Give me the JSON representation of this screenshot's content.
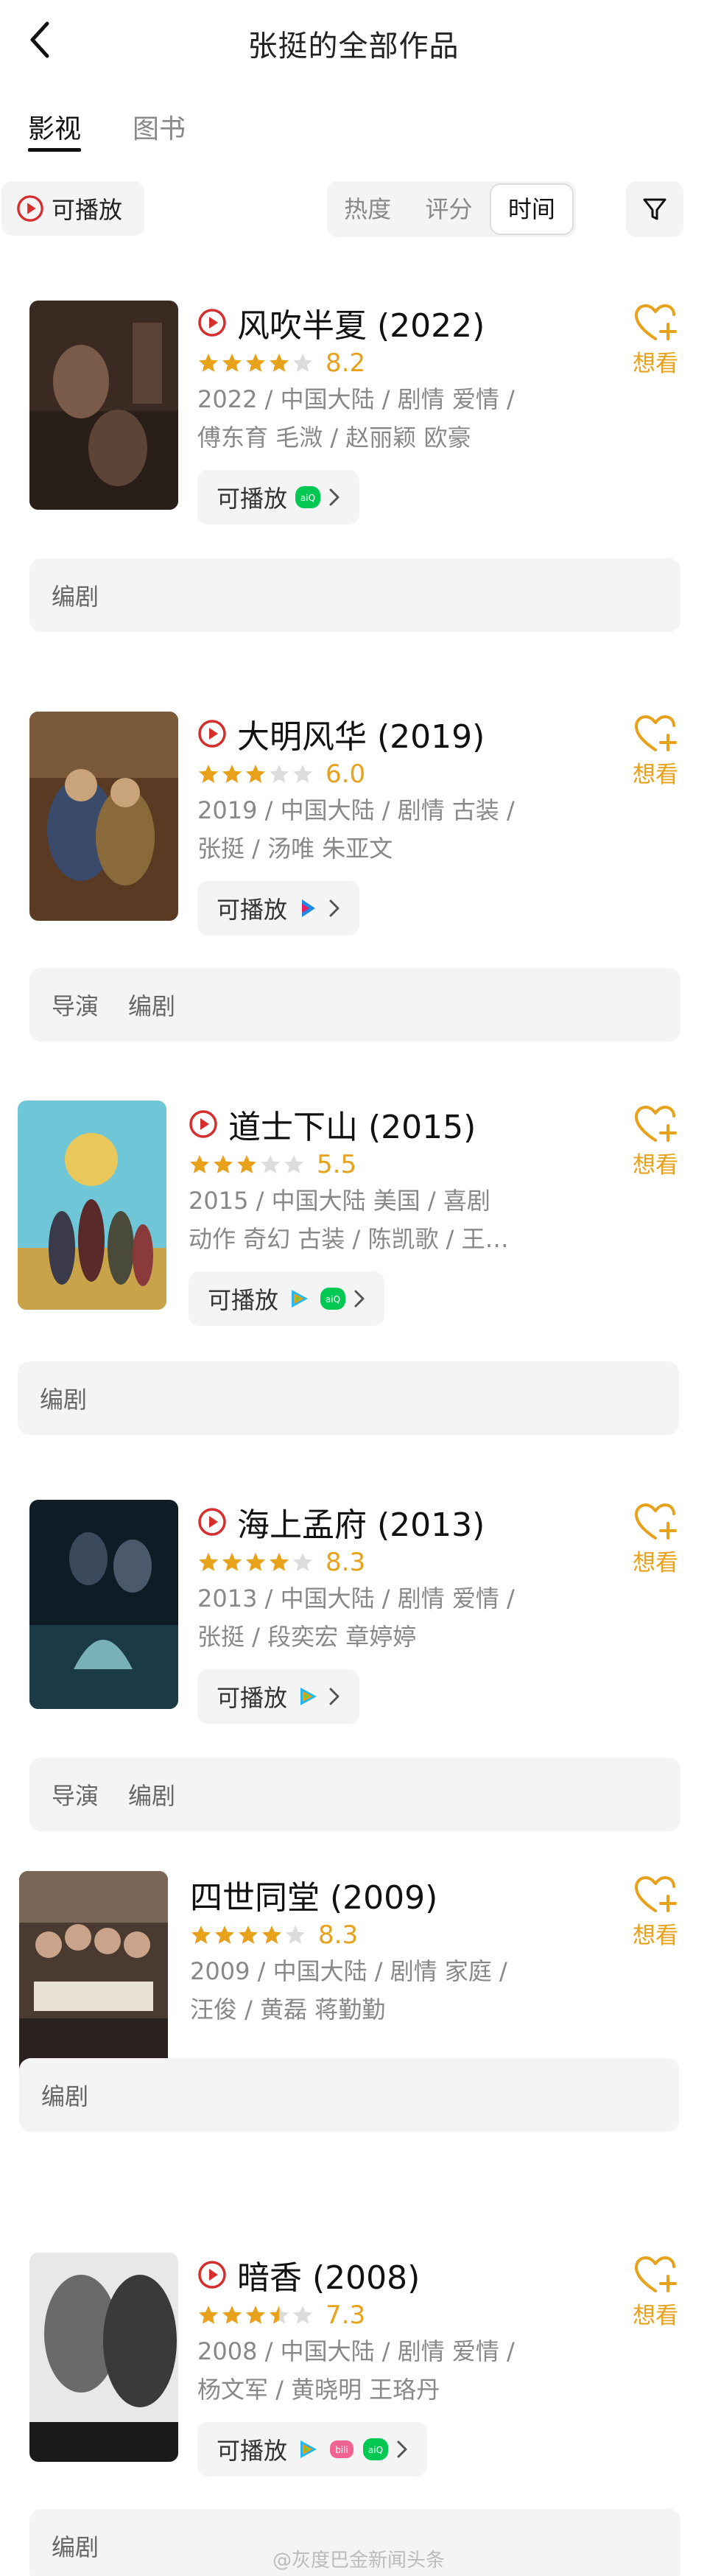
{
  "header": {
    "title": "张挺的全部作品"
  },
  "tabs": [
    {
      "label": "影视"
    },
    {
      "label": "图书"
    }
  ],
  "filters": {
    "playable_label": "可播放",
    "sort": [
      {
        "label": "热度"
      },
      {
        "label": "评分"
      },
      {
        "label": "时间"
      }
    ],
    "active_sort": "时间"
  },
  "colors": {
    "accent": "#e8a11a",
    "play_red": "#d62d2d",
    "chip_bg": "#f4f4f4"
  },
  "want_label": "想看",
  "play_btn_label": "可播放",
  "works": [
    {
      "title": "风吹半夏 (2022)",
      "playable": true,
      "stars": 4,
      "score": "8.2",
      "meta1": "2022 / 中国大陆 / 剧情 爱情 /",
      "meta2": "傅东育 毛溦 / 赵丽颖 欧豪",
      "platforms": [
        "iqiyi"
      ],
      "roles": [
        "编剧"
      ]
    },
    {
      "title": "大明风华 (2019)",
      "playable": true,
      "stars": 3,
      "score": "6.0",
      "meta1": "2019 / 中国大陆 / 剧情 古装 /",
      "meta2": "张挺 / 汤唯 朱亚文",
      "platforms": [
        "bilibili-tv"
      ],
      "roles": [
        "导演",
        "编剧"
      ]
    },
    {
      "title": "道士下山 (2015)",
      "playable": true,
      "stars": 3,
      "score": "5.5",
      "meta1": "2015 / 中国大陆 美国 / 喜剧",
      "meta2": "动作 奇幻 古装 / 陈凯歌 / 王…",
      "platforms": [
        "tencent",
        "iqiyi"
      ],
      "roles": [
        "编剧"
      ]
    },
    {
      "title": "海上孟府 (2013)",
      "playable": true,
      "stars": 4,
      "score": "8.3",
      "meta1": "2013 / 中国大陆 / 剧情 爱情 /",
      "meta2": "张挺 / 段奕宏 章婷婷",
      "platforms": [
        "tencent"
      ],
      "roles": [
        "导演",
        "编剧"
      ]
    },
    {
      "title": "四世同堂 (2009)",
      "playable": false,
      "stars": 4,
      "score": "8.3",
      "meta1": "2009 / 中国大陆 / 剧情 家庭 /",
      "meta2": "汪俊 / 黄磊 蒋勤勤",
      "platforms": [],
      "roles": [
        "编剧"
      ]
    },
    {
      "title": "暗香 (2008)",
      "playable": true,
      "stars": 3.5,
      "score": "7.3",
      "meta1": "2008 / 中国大陆 / 剧情 爱情 /",
      "meta2": "杨文军 / 黄晓明 王珞丹",
      "platforms": [
        "tencent",
        "bilibili",
        "iqiyi"
      ],
      "roles": [
        "编剧"
      ]
    }
  ],
  "watermark": "@灰度巴金新闻头条"
}
